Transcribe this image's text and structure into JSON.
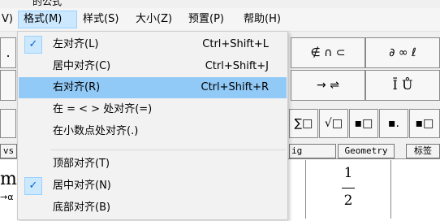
{
  "window": {
    "title_fragment": "的公式"
  },
  "menubar": {
    "items": [
      {
        "label": "V)"
      },
      {
        "label": "格式(M)"
      },
      {
        "label": "样式(S)"
      },
      {
        "label": "大小(Z)"
      },
      {
        "label": "预置(P)"
      },
      {
        "label": "帮助(H)"
      }
    ]
  },
  "format_menu": {
    "items": [
      {
        "label": "左对齐(L)",
        "shortcut": "Ctrl+Shift+L",
        "checked": true
      },
      {
        "label": "居中对齐(C)",
        "shortcut": "Ctrl+Shift+J",
        "checked": false
      },
      {
        "label": "右对齐(R)",
        "shortcut": "Ctrl+Shift+R",
        "checked": false
      },
      {
        "label": "在 = < > 处对齐(=)",
        "shortcut": "",
        "checked": false
      },
      {
        "label": "在小数点处对齐(.)",
        "shortcut": "",
        "checked": false
      },
      {
        "label": "顶部对齐(T)",
        "shortcut": "",
        "checked": false
      },
      {
        "label": "居中对齐(N)",
        "shortcut": "",
        "checked": true
      },
      {
        "label": "底部对齐(B)",
        "shortcut": "",
        "checked": false
      }
    ]
  },
  "palette": {
    "row1": [
      "∉ ∩ ⊂",
      "∂ ∞ ℓ"
    ],
    "row2": [
      "→ ⇌",
      "Ī  Ů"
    ],
    "row3": [
      "∑□",
      "√□",
      "▪□",
      "▪.",
      "▪□"
    ],
    "left_fragments": [
      ".",
      ""
    ]
  },
  "tabs": [
    {
      "label": "vs"
    },
    {
      "label": "ig"
    },
    {
      "label": "Geometry"
    },
    {
      "label": "标签"
    }
  ],
  "document": {
    "left_fragment": "m",
    "left_fragment_sub": "→α",
    "fraction": {
      "numerator": "1",
      "denominator": "2"
    }
  }
}
